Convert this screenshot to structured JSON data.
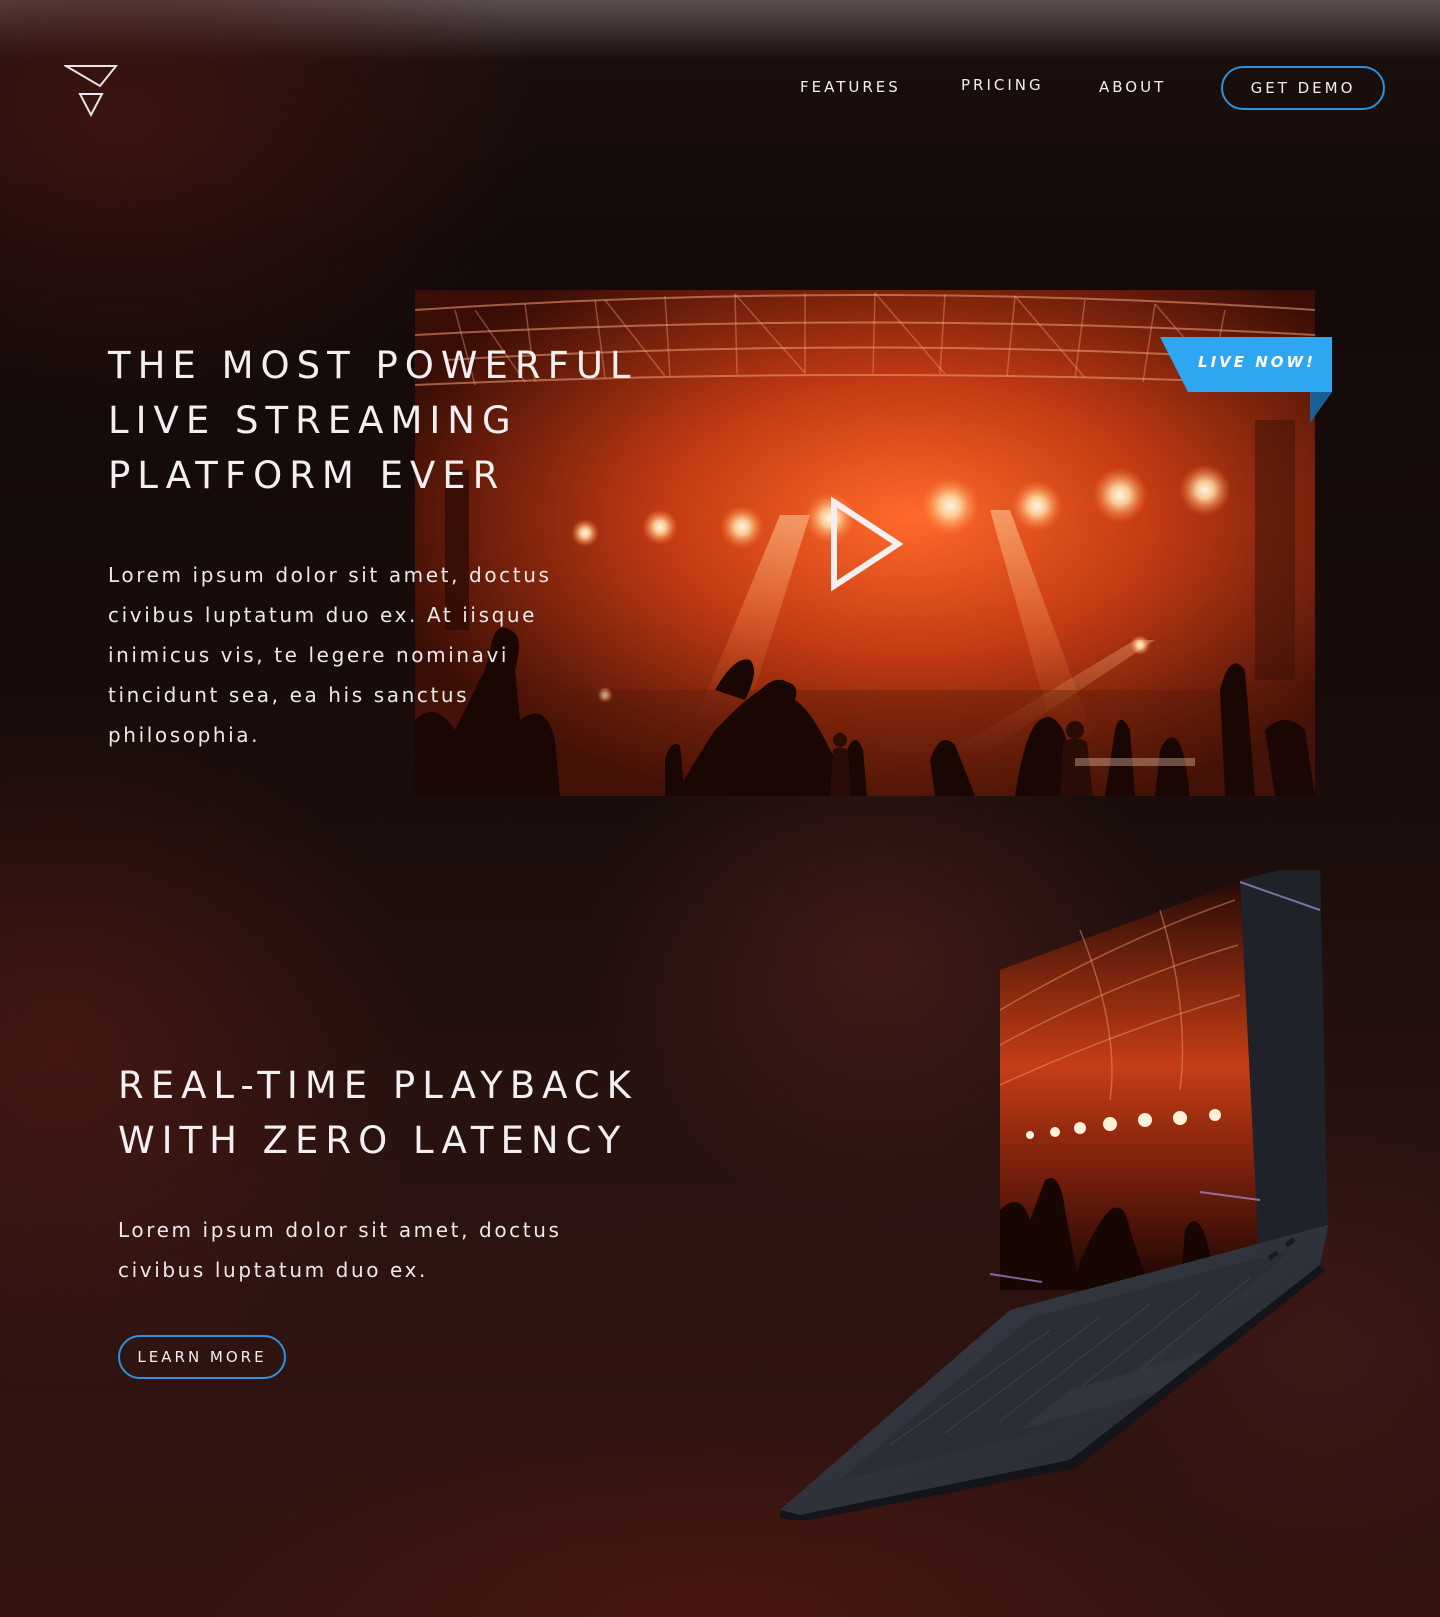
{
  "nav": {
    "logo_icon": "triangle-logo-icon",
    "links": [
      {
        "label": "FEATURES"
      },
      {
        "label": "PRICING"
      },
      {
        "label": "ABOUT"
      }
    ],
    "cta_label": "GET DEMO"
  },
  "hero": {
    "title": "THE MOST POWERFUL LIVE STREAMING PLATFORM EVER",
    "body": "Lorem ipsum dolor sit amet, doctus civibus luptatum duo ex. At iisque inimicus vis, te legere nominavi tincidunt sea, ea his sanctus philosophia.",
    "badge": "LIVE NOW!",
    "play_icon": "play-icon"
  },
  "feature": {
    "title": "REAL-TIME PLAYBACK WITH ZERO LATENCY",
    "body": "Lorem ipsum dolor sit amet, doctus civibus luptatum duo ex.",
    "cta_label": "LEARN MORE"
  },
  "colors": {
    "accent": "#2f8fe0",
    "badge": "#2ea6f2",
    "badge_shadow": "#1a5f96",
    "text": "#f2eff1"
  }
}
